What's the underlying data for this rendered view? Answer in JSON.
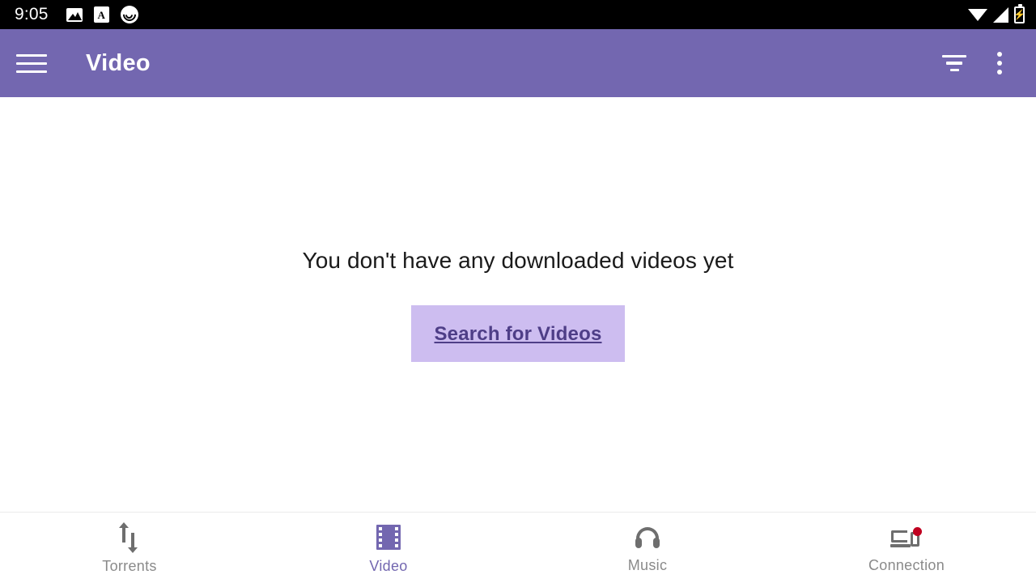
{
  "status_bar": {
    "clock": "9:05",
    "left_icons": [
      {
        "name": "photo-icon",
        "glyph": "image"
      },
      {
        "name": "font-icon",
        "glyph": "A"
      },
      {
        "name": "bittorrent-icon",
        "glyph": "bt-swirl"
      }
    ],
    "right_icons": [
      {
        "name": "wifi-icon"
      },
      {
        "name": "cellular-signal-icon"
      },
      {
        "name": "battery-charging-icon",
        "glyph": "⚡"
      }
    ],
    "background_color": "#000000",
    "foreground_color": "#ffffff"
  },
  "app_bar": {
    "title": "Video",
    "menu_label": "Menu",
    "filter_label": "Filter",
    "overflow_label": "More options",
    "background_color": "#7367B0",
    "text_color": "#ffffff"
  },
  "main": {
    "empty_message": "You don't have any downloaded videos yet",
    "search_link_label": "Search for Videos",
    "search_link_bg": "#CDBDF0",
    "search_link_color": "#4E3E87"
  },
  "bottom_nav": {
    "active_color": "#7367B0",
    "inactive_color": "#8a8a8a",
    "badge_color": "#C00020",
    "items": [
      {
        "label": "Torrents",
        "icon": "up-down-arrows-icon",
        "active": false,
        "badge": false
      },
      {
        "label": "Video",
        "icon": "film-strip-icon",
        "active": true,
        "badge": false
      },
      {
        "label": "Music",
        "icon": "headphones-icon",
        "active": false,
        "badge": false
      },
      {
        "label": "Connection",
        "icon": "devices-icon",
        "active": false,
        "badge": true
      }
    ]
  }
}
